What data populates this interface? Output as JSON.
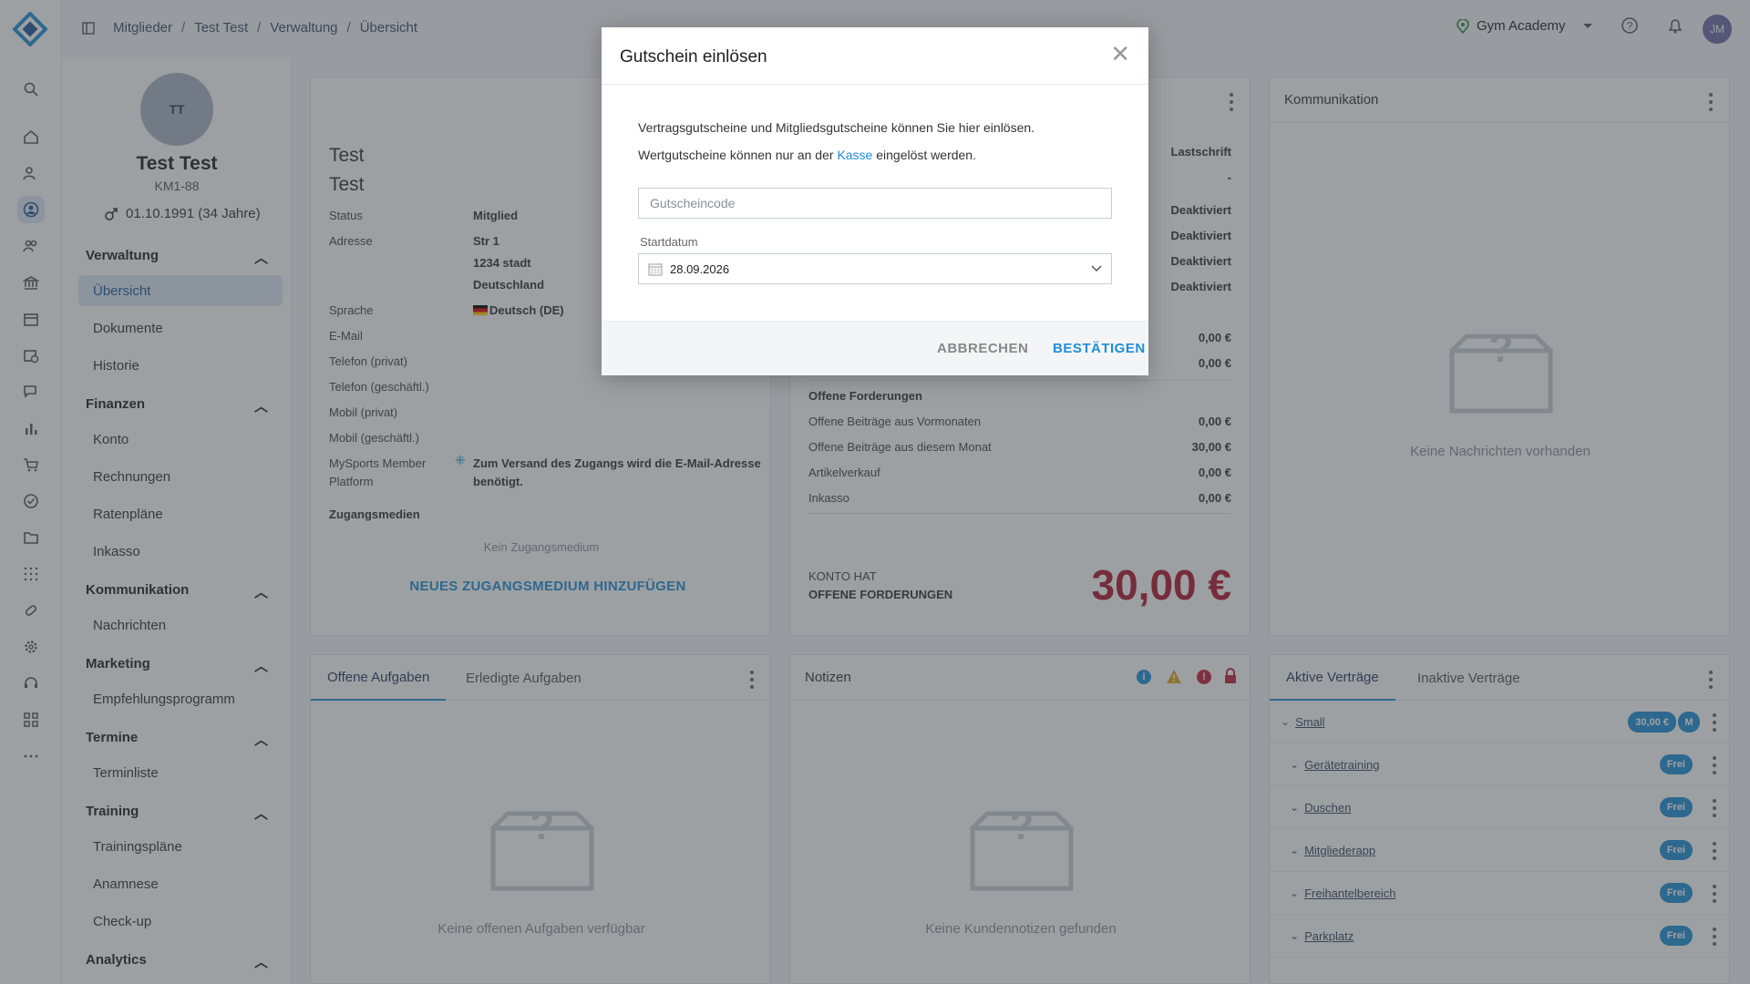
{
  "breadcrumb": [
    "Mitglieder",
    "Test Test",
    "Verwaltung",
    "Übersicht"
  ],
  "org": {
    "name": "Gym Academy"
  },
  "user": {
    "initials": "JM"
  },
  "profile": {
    "initials": "TT",
    "name": "Test Test",
    "id": "KM1-88",
    "birth": "01.10.1991 (34 Jahre)"
  },
  "nav": {
    "sections": [
      {
        "title": "Verwaltung",
        "items": [
          "Übersicht",
          "Dokumente",
          "Historie"
        ]
      },
      {
        "title": "Finanzen",
        "items": [
          "Konto",
          "Rechnungen",
          "Ratenpläne",
          "Inkasso"
        ]
      },
      {
        "title": "Kommunikation",
        "items": [
          "Nachrichten"
        ]
      },
      {
        "title": "Marketing",
        "items": [
          "Empfehlungsprogramm"
        ]
      },
      {
        "title": "Termine",
        "items": [
          "Terminliste"
        ]
      },
      {
        "title": "Training",
        "items": [
          "Trainingspläne",
          "Anamnese",
          "Check-up"
        ]
      },
      {
        "title": "Analytics",
        "items": []
      }
    ]
  },
  "member": {
    "first": "Test",
    "last": "Test",
    "fields": {
      "status_label": "Status",
      "status_value": "Mitglied",
      "address_label": "Adresse",
      "address_1": "Str 1",
      "address_2": "1234 stadt",
      "address_3": "Deutschland",
      "lang_label": "Sprache",
      "lang_value": "Deutsch (DE)",
      "email_label": "E-Mail",
      "phone_private": "Telefon (privat)",
      "phone_business": "Telefon (geschäftl.)",
      "mobile_private": "Mobil (privat)",
      "mobile_business": "Mobil (geschäftl.)",
      "platform_label_1": "MySports Member",
      "platform_label_2": "Platform",
      "platform_note_1": "Zum Versand des Zugangs wird die E-Mail-Adresse",
      "platform_note_2": "benötigt.",
      "media_label": "Zugangsmedien",
      "media_empty": "Kein Zugangsmedium",
      "media_add": "NEUES ZUGANGSMEDIUM HINZUFÜGEN"
    }
  },
  "account": {
    "payment": "Lastschrift",
    "dash": "-",
    "states": [
      "Deaktiviert",
      "Deaktiviert",
      "Deaktiviert",
      "Deaktiviert"
    ],
    "amounts_top": [
      "0,00 €",
      "0,00 €"
    ],
    "claims_title": "Offene Forderungen",
    "claims": [
      {
        "label": "Offene Beiträge aus Vormonaten",
        "value": "0,00 €"
      },
      {
        "label": "Offene Beiträge aus diesem Monat",
        "value": "30,00 €"
      },
      {
        "label": "Artikelverkauf",
        "value": "0,00 €"
      },
      {
        "label": "Inkasso",
        "value": "0,00 €"
      }
    ],
    "summary_1": "KONTO HAT",
    "summary_2": "OFFENE FORDERUNGEN",
    "total": "30,00 €"
  },
  "communication": {
    "title": "Kommunikation",
    "empty": "Keine Nachrichten vorhanden"
  },
  "tasks": {
    "tab_open": "Offene Aufgaben",
    "tab_done": "Erledigte Aufgaben",
    "empty": "Keine offenen Aufgaben verfügbar"
  },
  "notes": {
    "title": "Notizen",
    "empty": "Keine Kundennotizen gefunden"
  },
  "contracts": {
    "tab_active": "Aktive Verträge",
    "tab_inactive": "Inaktive Verträge",
    "main": {
      "name": "Small",
      "price": "30,00 €",
      "tag": "M"
    },
    "modules": [
      {
        "name": "Gerätetraining",
        "badge": "Frei"
      },
      {
        "name": "Duschen",
        "badge": "Frei"
      },
      {
        "name": "Mitgliederapp",
        "badge": "Frei"
      },
      {
        "name": "Freihantelbereich",
        "badge": "Frei"
      },
      {
        "name": "Parkplatz",
        "badge": "Frei"
      }
    ]
  },
  "modal": {
    "title": "Gutschein einlösen",
    "text_1": "Vertragsgutscheine und Mitgliedsgutscheine können Sie hier einlösen.",
    "text_2_pre": "Wertgutscheine können nur an der",
    "text_2_link": "Kasse",
    "text_2_post": "eingelöst werden.",
    "code_placeholder": "Gutscheincode",
    "date_label": "Startdatum",
    "date_value": "28.09.2026",
    "cancel": "ABBRECHEN",
    "confirm": "BESTÄTIGEN"
  },
  "colors": {
    "accent": "#1f8fd6",
    "total": "#b0182f"
  }
}
